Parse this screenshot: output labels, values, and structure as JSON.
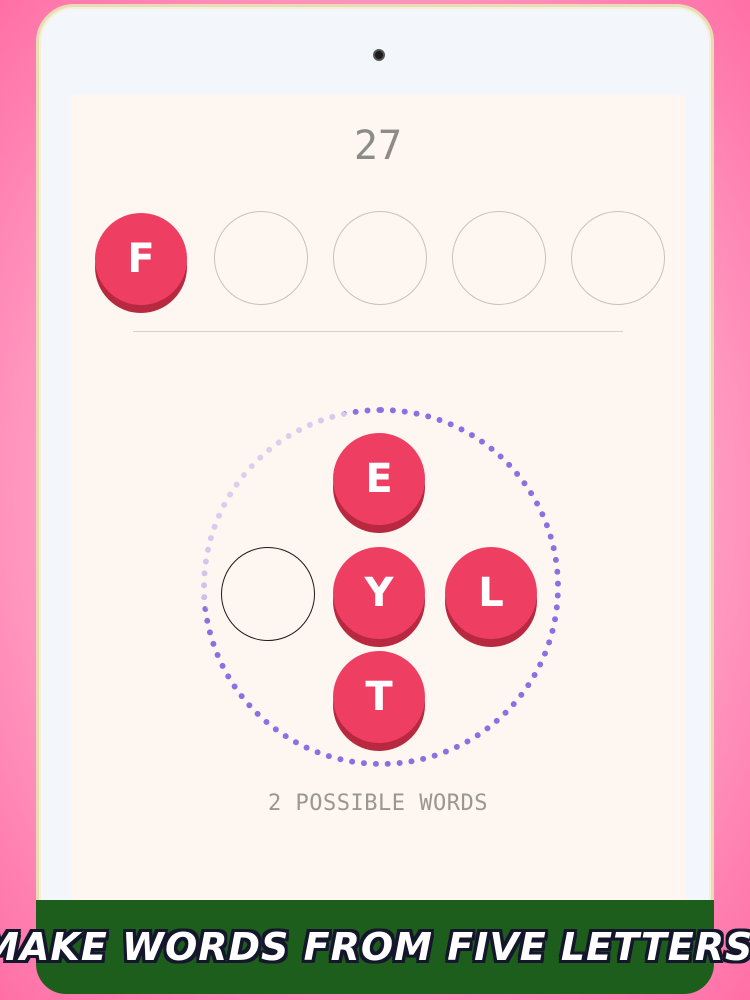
{
  "game": {
    "score": "27",
    "answer_slots": [
      "F",
      "",
      "",
      "",
      ""
    ],
    "wheel_tiles": {
      "top": "E",
      "center": "Y",
      "right": "L",
      "bottom": "T",
      "left": ""
    },
    "hint": "2 POSSIBLE WORDS"
  },
  "banner": {
    "caption": "MAKE WORDS FROM FIVE LETTERS."
  },
  "colors": {
    "tile": "#ee3f63",
    "tile_shadow": "#b8283f",
    "ring": "#8c6fe0",
    "banner_bg": "#1e5e1c"
  },
  "icons": {
    "camera": "front-camera-icon"
  }
}
